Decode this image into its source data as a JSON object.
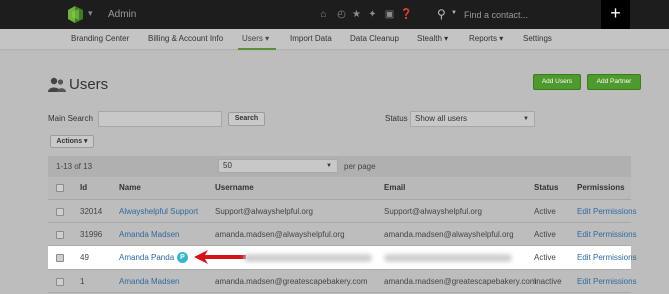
{
  "app": {
    "title": "Admin"
  },
  "search": {
    "placeholder": "Find a contact..."
  },
  "topbar": {
    "add_label": "+"
  },
  "nav": [
    {
      "label": "Branding Center"
    },
    {
      "label": "Billing & Account Info"
    },
    {
      "label": "Users ▾"
    },
    {
      "label": "Import Data"
    },
    {
      "label": "Data Cleanup"
    },
    {
      "label": "Stealth ▾"
    },
    {
      "label": "Reports ▾"
    },
    {
      "label": "Settings"
    }
  ],
  "page": {
    "title": "Users",
    "add_users": "Add Users",
    "add_partner": "Add Partner"
  },
  "filters": {
    "main_search_label": "Main Search",
    "search_button": "Search",
    "status_label": "Status",
    "status_value": "Show all users",
    "actions_button": "Actions ▾"
  },
  "pagination": {
    "range": "1-13 of 13",
    "per_page_value": "50",
    "per_page_label": "per page"
  },
  "table": {
    "headers": [
      "Id",
      "Name",
      "Username",
      "Email",
      "Status",
      "Permissions"
    ],
    "rows": [
      {
        "id": "32014",
        "name": "Alwayshelpful Support",
        "username": "Support@alwayshelpful.org",
        "email": "Support@alwayshelpful.org",
        "status": "Active",
        "permissions": "Edit Permissions"
      },
      {
        "id": "31996",
        "name": "Amanda Madsen",
        "username": "amanda.madsen@alwayshelpful.org",
        "email": "amanda.madsen@alwayshelpful.org",
        "status": "Active",
        "permissions": "Edit Permissions"
      },
      {
        "id": "49",
        "name": "Amanda Panda",
        "badge": "P",
        "username": "",
        "email": "",
        "status": "Active",
        "permissions": "Edit Permissions"
      },
      {
        "id": "1",
        "name": "Amanda Madsen",
        "username": "amanda.madsen@greatescapebakery.com",
        "email": "amanda.madsen@greatescapebakery.com",
        "status": "Inactive",
        "permissions": "Edit Permissions"
      }
    ]
  },
  "colors": {
    "accent_green": "#4f9a2d",
    "link_blue": "#2f6aa0",
    "badge_teal": "#39b3c9",
    "arrow_red": "#d3141b"
  },
  "icons": [
    "logo-icon",
    "home-icon",
    "clock-icon",
    "star-icon",
    "puzzle-icon",
    "building-icon",
    "help-icon",
    "search-icon",
    "users-icon",
    "arrow-icon"
  ]
}
